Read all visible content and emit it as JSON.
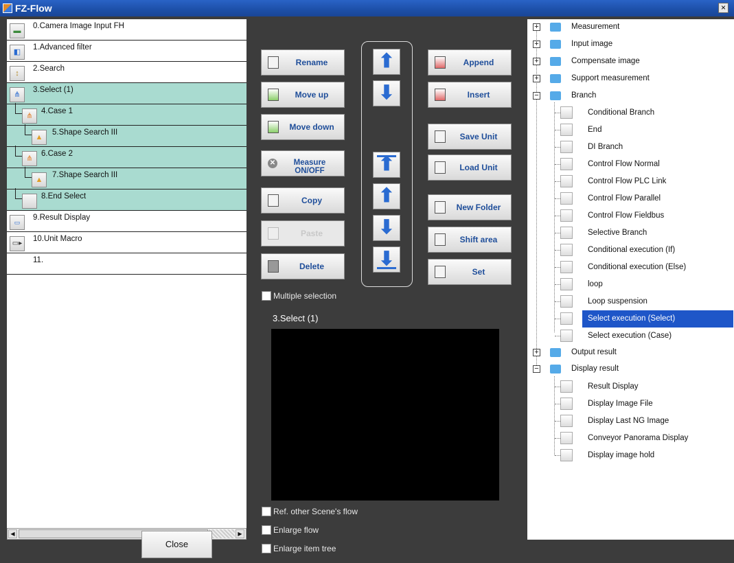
{
  "window": {
    "title": "FZ-Flow",
    "close_glyph": "×"
  },
  "flow": {
    "items": [
      {
        "label": "0.Camera Image Input FH",
        "icon": "camera-icon"
      },
      {
        "label": "1.Advanced filter",
        "icon": "filter-icon"
      },
      {
        "label": "2.Search",
        "icon": "search-unit-icon"
      },
      {
        "label": "3.Select (1)",
        "icon": "select-icon"
      },
      {
        "label": "4.Case 1",
        "icon": "case-icon"
      },
      {
        "label": "5.Shape Search III",
        "icon": "shape-search-icon"
      },
      {
        "label": "6.Case 2",
        "icon": "case-icon"
      },
      {
        "label": "7.Shape Search III",
        "icon": "shape-search-icon"
      },
      {
        "label": "8.End Select",
        "icon": "end-select-icon"
      },
      {
        "label": "9.Result Display",
        "icon": "result-display-icon"
      },
      {
        "label": "10.Unit Macro",
        "icon": "unit-macro-icon"
      },
      {
        "label": "11.",
        "icon": ""
      }
    ],
    "close_label": "Close"
  },
  "buttons": {
    "rename": "Rename",
    "move_up": "Move up",
    "move_down": "Move down",
    "measure_onoff": "Measure ON/OFF",
    "copy": "Copy",
    "paste": "Paste",
    "delete": "Delete",
    "append": "Append",
    "insert": "Insert",
    "save_unit": "Save Unit",
    "load_unit": "Load Unit",
    "new_folder": "New Folder",
    "shift_area": "Shift area",
    "set": "Set"
  },
  "options": {
    "multiple_selection": "Multiple selection",
    "ref_other_scene": "Ref. other Scene's flow",
    "enlarge_flow": "Enlarge flow",
    "enlarge_item_tree": "Enlarge item tree"
  },
  "preview": {
    "title": "3.Select (1)"
  },
  "tree": {
    "categories": [
      {
        "label": "Measurement",
        "expanded": false
      },
      {
        "label": "Input image",
        "expanded": false
      },
      {
        "label": "Compensate image",
        "expanded": false
      },
      {
        "label": "Support measurement",
        "expanded": false
      },
      {
        "label": "Branch",
        "expanded": true
      },
      {
        "label": "Output result",
        "expanded": false
      },
      {
        "label": "Display result",
        "expanded": true
      }
    ],
    "branch_items": [
      "Conditional Branch",
      "End",
      "DI Branch",
      "Control Flow Normal",
      "Control Flow PLC Link",
      "Control Flow Parallel",
      "Control Flow Fieldbus",
      "Selective Branch",
      "Conditional execution (If)",
      "Conditional execution (Else)",
      "loop",
      "Loop suspension",
      "Select execution (Select)",
      "Select execution (Case)"
    ],
    "display_items": [
      "Result Display",
      "Display Image File",
      "Display Last NG Image",
      "Conveyor Panorama Display",
      "Display image hold"
    ],
    "selected": "Select execution (Select)",
    "expand_glyph": "+",
    "collapse_glyph": "−"
  },
  "colors": {
    "selected_row": "#a9dbd0",
    "tree_selection": "#1e56c8",
    "accent": "#2a6bd1"
  }
}
